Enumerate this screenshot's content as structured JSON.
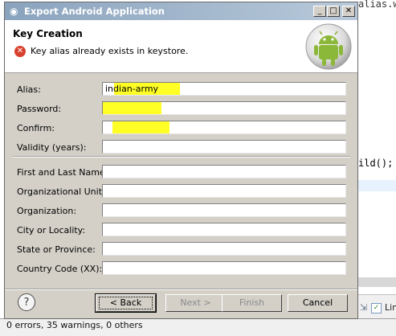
{
  "background": {
    "code_line1": "alias.wr",
    "code_line2": "ild();",
    "tab_label": "Lin",
    "status_text": "0 errors, 35 warnings, 0 others"
  },
  "dialog": {
    "title": "Export Android Application",
    "window_buttons": {
      "minimize": "_",
      "maximize": "□",
      "close": "✕"
    }
  },
  "header": {
    "title": "Key Creation",
    "error_message": "Key alias already exists in keystore."
  },
  "form": {
    "alias": {
      "label": "Alias:",
      "value": "indian-army"
    },
    "password": {
      "label": "Password:",
      "value": ""
    },
    "confirm": {
      "label": "Confirm:",
      "value": ""
    },
    "validity": {
      "label": "Validity (years):",
      "value": ""
    },
    "name": {
      "label": "First and Last Name:",
      "value": ""
    },
    "org_unit": {
      "label": "Organizational Unit:",
      "value": ""
    },
    "organization": {
      "label": "Organization:",
      "value": ""
    },
    "city": {
      "label": "City or Locality:",
      "value": ""
    },
    "state": {
      "label": "State or Province:",
      "value": ""
    },
    "country": {
      "label": "Country Code (XX):",
      "value": ""
    }
  },
  "buttons": {
    "help": "?",
    "back": "< Back",
    "next": "Next >",
    "finish": "Finish",
    "cancel": "Cancel"
  },
  "colors": {
    "highlight": "#ffff26",
    "title_bar": "#8aa3bd",
    "error": "#d9412f",
    "android_green": "#8cb83a"
  }
}
